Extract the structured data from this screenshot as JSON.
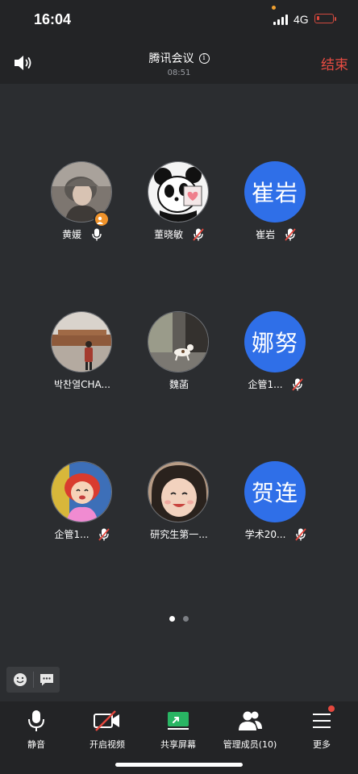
{
  "status_bar": {
    "time": "16:04",
    "network": "4G",
    "signal_icon": "signal-bars-icon",
    "battery_icon": "battery-low-icon",
    "battery_color": "#e0453a"
  },
  "header": {
    "title": "腾讯会议",
    "duration": "08:51",
    "end_label": "结束",
    "end_color": "#e94c42",
    "speaker_icon": "speaker-icon",
    "info_icon": "info-icon",
    "info_glyph": "i"
  },
  "participants": [
    {
      "name": "黄媛",
      "avatar_type": "photo",
      "mic": "on",
      "host": true
    },
    {
      "name": "董晓敏",
      "avatar_type": "photo",
      "mic": "muted"
    },
    {
      "name": "崔岩",
      "avatar_type": "text",
      "avatar_text": "崔岩",
      "mic": "muted"
    },
    {
      "name": "박찬열CHA...",
      "avatar_type": "photo",
      "mic": "none"
    },
    {
      "name": "魏菡",
      "avatar_type": "photo",
      "mic": "none"
    },
    {
      "name": "企管1...",
      "avatar_type": "text",
      "avatar_text": "娜努",
      "mic": "muted"
    },
    {
      "name": "企管1...",
      "avatar_type": "photo",
      "mic": "muted"
    },
    {
      "name": "研究生第一...",
      "avatar_type": "photo",
      "mic": "none"
    },
    {
      "name": "学术20...",
      "avatar_type": "text",
      "avatar_text": "贺连",
      "mic": "muted"
    }
  ],
  "accent_color": "#2f6fe8",
  "pager": {
    "pages": 2,
    "current": 1
  },
  "chat_tools": {
    "emoji_icon": "emoji-icon",
    "message_icon": "message-icon"
  },
  "toolbar": {
    "mute_label": "静音",
    "video_label": "开启视频",
    "share_label": "共享屏幕",
    "members_label": "管理成员(10)",
    "more_label": "更多",
    "share_color": "#29b563"
  }
}
